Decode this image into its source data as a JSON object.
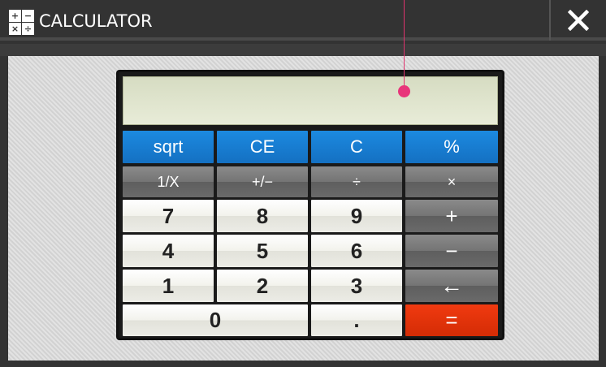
{
  "window": {
    "title": "CALCULATOR",
    "icon": "calculator-icon",
    "close_icon": "close-icon",
    "icon_glyphs": [
      "+",
      "−",
      "×",
      "÷"
    ]
  },
  "display": {
    "value": ""
  },
  "keys": {
    "row1": [
      "sqrt",
      "CE",
      "C",
      "%"
    ],
    "row2": [
      "1/X",
      "+/−",
      "÷",
      "×"
    ],
    "row3": [
      "7",
      "8",
      "9",
      "+"
    ],
    "row4": [
      "4",
      "5",
      "6",
      "−"
    ],
    "row5": [
      "1",
      "2",
      "3",
      "←"
    ],
    "row6": [
      "0",
      ".",
      "="
    ]
  },
  "colors": {
    "titlebar": "#333333",
    "blue_key": "#1c8ae0",
    "gray_key": "#747474",
    "white_key": "#f2f2ec",
    "equals_key": "#e0340a",
    "display_bg": "#e0e5cf",
    "pointer": "#e8357a"
  }
}
